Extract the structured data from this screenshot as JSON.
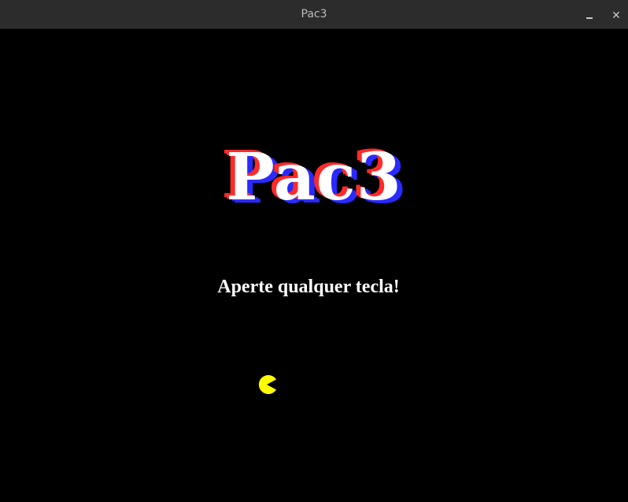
{
  "window": {
    "title": "Pac3",
    "minimize_icon": "minimize-icon",
    "close_icon": "close-icon",
    "close_label": "✕"
  },
  "game": {
    "logo": "Pac3",
    "prompt": "Aperte qualquer tecla!",
    "colors": {
      "background": "#000000",
      "logo_fill": "#ffffff",
      "logo_shadow_left": "#ff2a2a",
      "logo_shadow_right": "#2a2aff",
      "pacman": "#ffff00"
    }
  }
}
